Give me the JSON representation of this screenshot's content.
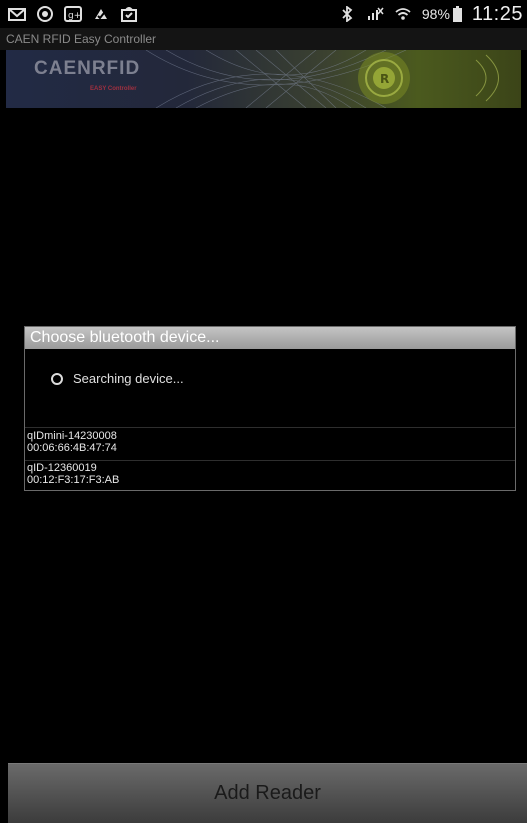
{
  "status_bar": {
    "left_icons": [
      "gmail-icon",
      "vpn-icon",
      "google-plus-icon",
      "sync-icon",
      "shopping-bag-icon"
    ],
    "right_icons": [
      "bluetooth-icon",
      "signal-muted-icon",
      "wifi-icon"
    ],
    "battery_text": "98%",
    "time": "11:25"
  },
  "app": {
    "title": "CAEN RFID Easy Controller"
  },
  "banner": {
    "brand": "CAENRFID",
    "subtitle": "EASY Controller"
  },
  "dialog": {
    "title": "Choose bluetooth device...",
    "searching_text": "Searching device...",
    "devices": [
      {
        "name": "qIDmini-14230008",
        "address": "00:06:66:4B:47:74"
      },
      {
        "name": "qID-12360019",
        "address": "00:12:F3:17:F3:AB"
      }
    ]
  },
  "footer": {
    "add_reader_label": "Add Reader"
  }
}
